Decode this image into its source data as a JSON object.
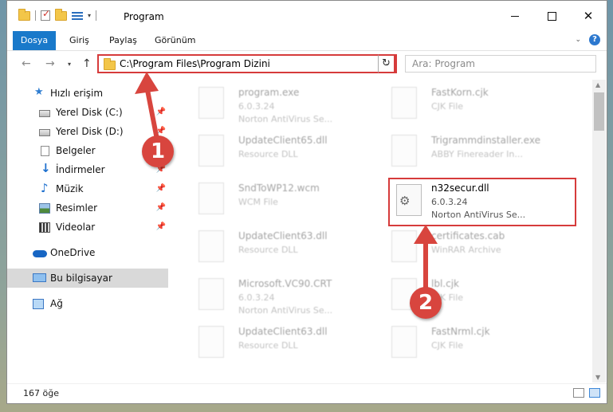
{
  "window": {
    "title": "Program",
    "controls": {
      "minimize": "minimize",
      "maximize": "maximize",
      "close": "✕"
    }
  },
  "ribbon": {
    "tabs": [
      {
        "label": "Dosya",
        "active": true
      },
      {
        "label": "Giriş"
      },
      {
        "label": "Paylaş"
      },
      {
        "label": "Görünüm"
      }
    ],
    "help": "?"
  },
  "nav": {
    "back": "←",
    "forward": "→",
    "recent": "▾",
    "up": "↑",
    "address": "C:\\Program Files\\Program Dizini",
    "address_chevron": "⌄",
    "refresh": "↻",
    "search_placeholder": "Ara: Program"
  },
  "sidebar": {
    "items": [
      {
        "label": "Hızlı erişim",
        "icon": "star-icon"
      },
      {
        "label": "Yerel Disk (C:)",
        "icon": "drive-icon",
        "pinned": true
      },
      {
        "label": "Yerel Disk (D:)",
        "icon": "drive-icon",
        "pinned": true
      },
      {
        "label": "Belgeler",
        "icon": "document-icon",
        "pinned": true
      },
      {
        "label": "İndirmeler",
        "icon": "download-icon",
        "pinned": true
      },
      {
        "label": "Müzik",
        "icon": "music-icon",
        "pinned": true
      },
      {
        "label": "Resimler",
        "icon": "pictures-icon",
        "pinned": true
      },
      {
        "label": "Videolar",
        "icon": "videos-icon",
        "pinned": true
      },
      {
        "label": "OneDrive",
        "icon": "onedrive-icon"
      },
      {
        "label": "Bu bilgisayar",
        "icon": "computer-icon",
        "selected": true
      },
      {
        "label": "Ağ",
        "icon": "network-icon"
      }
    ]
  },
  "files": [
    {
      "name": "program.exe",
      "line2": "6.0.3.24",
      "line3": "Norton AntiVirus Se..."
    },
    {
      "name": "FastKorn.cjk",
      "line2": "CJK File",
      "line3": ""
    },
    {
      "name": "UpdateClient65.dll",
      "line2": "Resource DLL",
      "line3": ""
    },
    {
      "name": "Trigrammdinstaller.exe",
      "line2": "ABBY Finereader In...",
      "line3": ""
    },
    {
      "name": "SndToWP12.wcm",
      "line2": "WCM File",
      "line3": ""
    },
    {
      "name": "n32secur.dll",
      "line2": "6.0.3.24",
      "line3": "Norton AntiVirus Se...",
      "highlight": true
    },
    {
      "name": "UpdateClient63.dll",
      "line2": "Resource DLL",
      "line3": ""
    },
    {
      "name": "certificates.cab",
      "line2": "WinRAR Archive",
      "line3": ""
    },
    {
      "name": "Microsoft.VC90.CRT",
      "line2": "6.0.3.24",
      "line3": "Norton AntiVirus Se..."
    },
    {
      "name": "lbl.cjk",
      "line2": "CJK File",
      "line3": ""
    },
    {
      "name": "UpdateClient63.dll",
      "line2": "Resource DLL",
      "line3": ""
    },
    {
      "name": "FastNrml.cjk",
      "line2": "CJK File",
      "line3": ""
    }
  ],
  "status": {
    "count": "167 öğe"
  },
  "annotations": {
    "callout1": "1",
    "callout2": "2"
  },
  "colors": {
    "accent": "#1979ca",
    "highlight": "#d63b3b",
    "callout": "#d8453e"
  }
}
